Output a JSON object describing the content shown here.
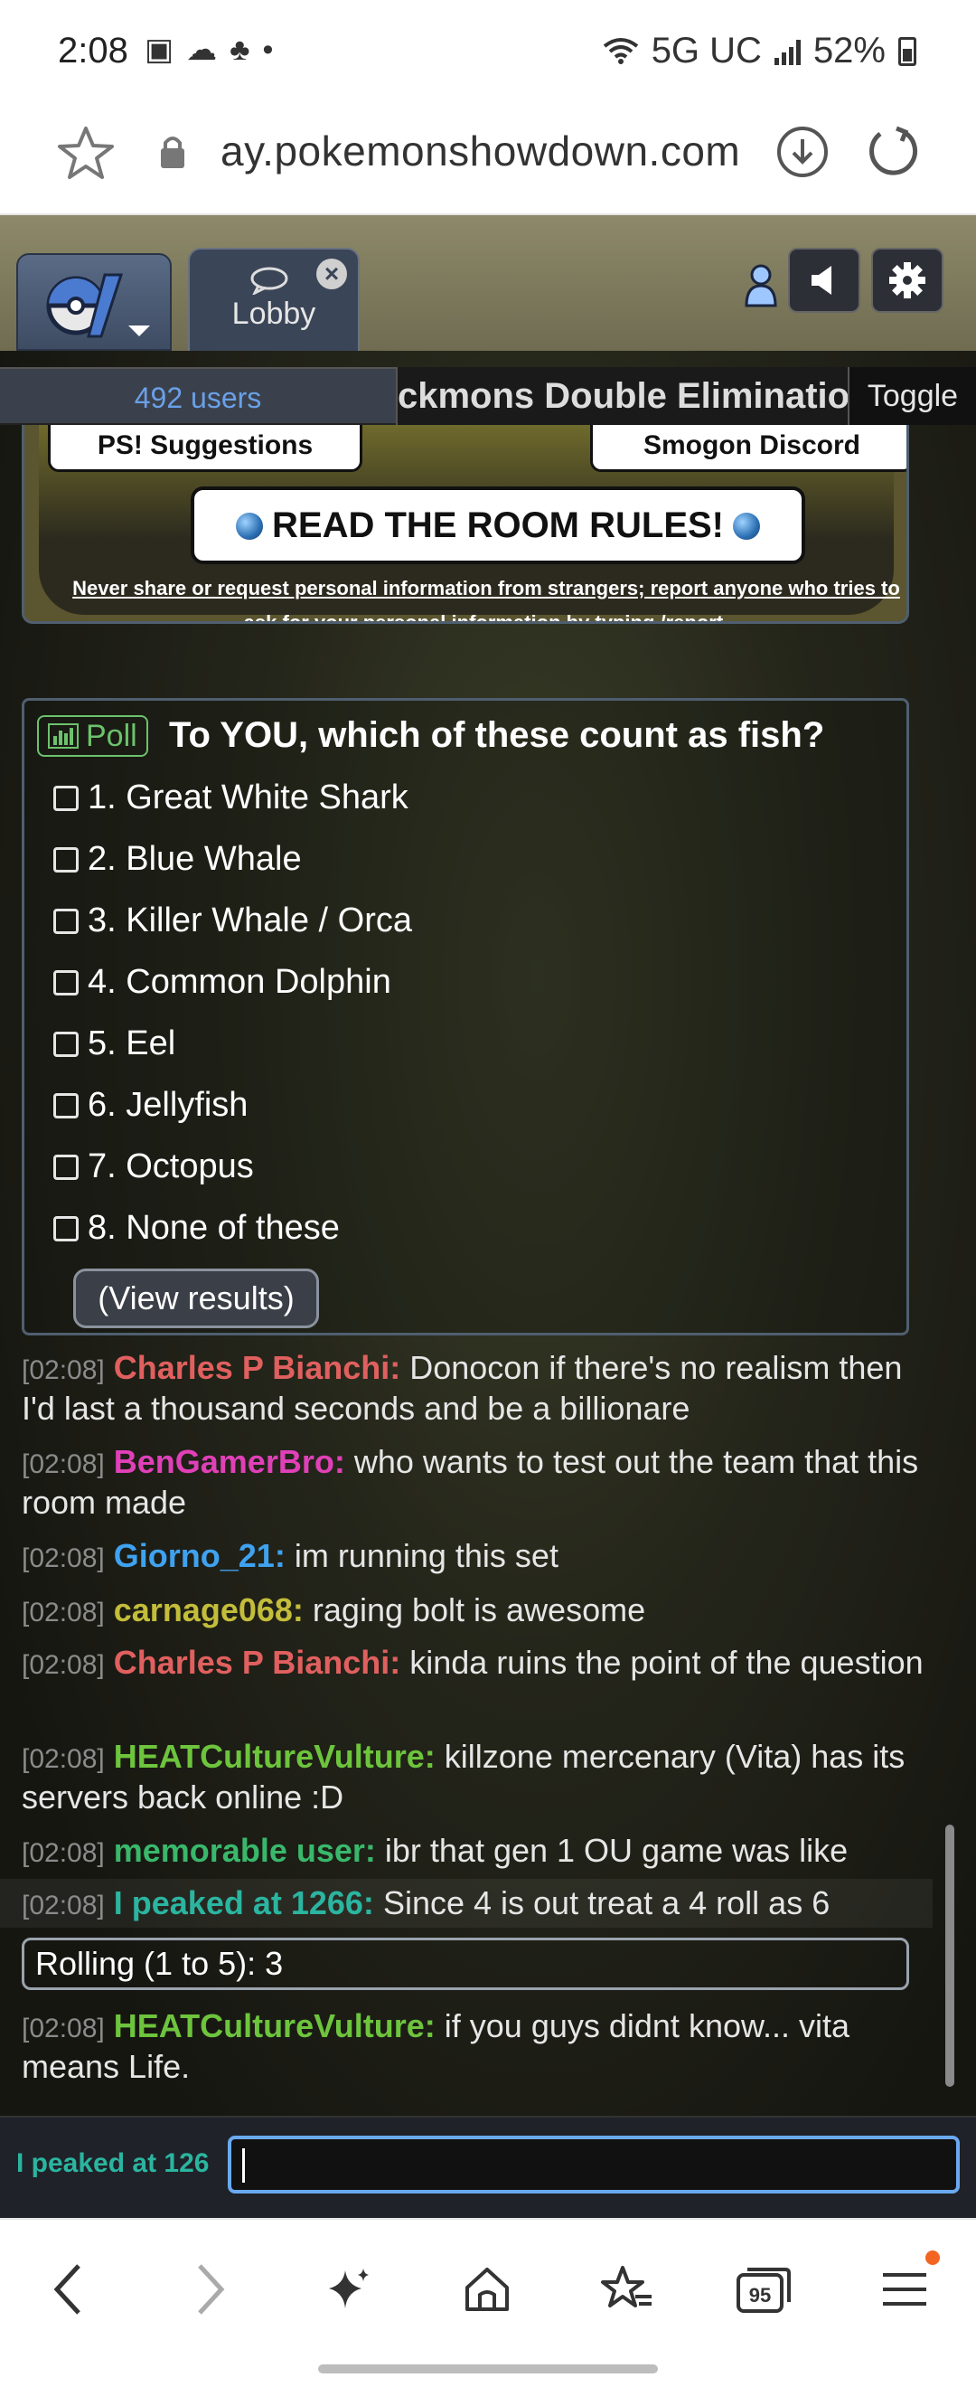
{
  "status_bar": {
    "time": "2:08",
    "network": "5G UC",
    "battery": "52%"
  },
  "browser": {
    "url": "ay.pokemonshowdown.com",
    "tab_count": "95"
  },
  "header": {
    "lobby_tab_label": "Lobby",
    "users_count": "492 users",
    "room_title": "ckmons Double Eliminatio",
    "toggle_label": "Toggle"
  },
  "rules": {
    "suggestions": "PS! Suggestions",
    "discord": "Smogon Discord",
    "read_rules": "READ THE ROOM RULES!",
    "note": "Never share or request personal information from strangers; report anyone who tries to ask for your personal information by typing /report."
  },
  "poll": {
    "badge": "Poll",
    "question": "To YOU, which of these count as fish?",
    "options": [
      "1. Great White Shark",
      "2. Blue Whale",
      "3. Killer Whale / Orca",
      "4. Common Dolphin",
      "5. Eel",
      "6. Jellyfish",
      "7. Octopus",
      "8. None of these"
    ],
    "view_results": "(View results)"
  },
  "chat": {
    "messages": [
      {
        "time": "[02:08]",
        "user": "Charles P Bianchi:",
        "color": "#e0605f",
        "text": "Donocon if there's no realism then I'd last a thousand seconds and be a billionare"
      },
      {
        "time": "[02:08]",
        "user": "BenGamerBro:",
        "color": "#e040b8",
        "text": "who wants to test out the team that this room made"
      },
      {
        "time": "[02:08]",
        "user": "Giorno_21:",
        "color": "#3fa2f0",
        "text": "im running this set"
      },
      {
        "time": "[02:08]",
        "user": "carnage068:",
        "color": "#c3bd3a",
        "text": "raging bolt is awesome"
      },
      {
        "time": "[02:08]",
        "user": "Charles P Bianchi:",
        "color": "#e0605f",
        "text": "kinda ruins the point of the question"
      },
      {
        "time": "[02:08]",
        "user": "HEATCultureVulture:",
        "color": "#6dc43d",
        "text": "killzone mercenary (Vita) has its servers back online :D"
      },
      {
        "time": "[02:08]",
        "user": "memorable user:",
        "color": "#39b86b",
        "text": "ibr that gen 1 OU game was like"
      },
      {
        "time": "[02:08]",
        "user": "I peaked at 1266:",
        "color": "#2bb5a0",
        "text": "Since 4 is out treat a 4 roll as 6"
      }
    ],
    "roll": "Rolling (1 to 5): 3",
    "last_message": {
      "time": "[02:08]",
      "user": "HEATCultureVulture:",
      "color": "#6dc43d",
      "text": "if you guys didnt know... vita means Life."
    }
  },
  "input": {
    "username": "I peaked at 126"
  }
}
